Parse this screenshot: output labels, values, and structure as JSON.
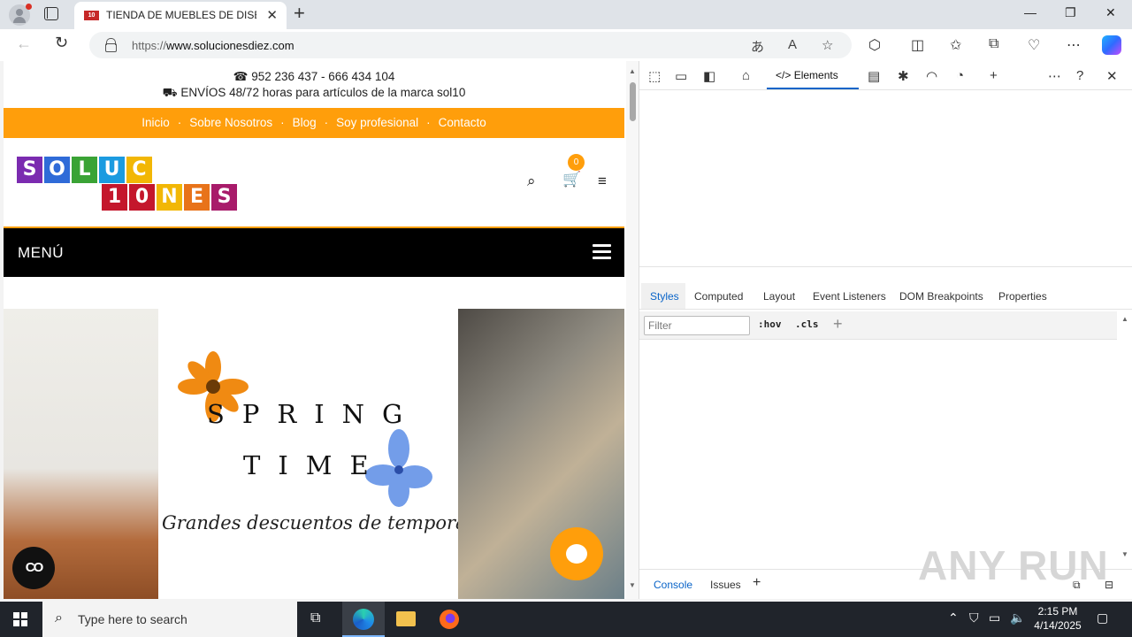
{
  "browser": {
    "tab_title": "TIENDA DE MUEBLES DE DISEÑO",
    "tab_favicon_text": "10",
    "url_prefix": "https://",
    "url_host": "www.solucionesdiez.com"
  },
  "site": {
    "phone": "☎ 952 236 437 - 666 434 104",
    "shipping": "⛟ ENVÍOS 48/72 horas para artículos de la marca sol10",
    "nav": [
      "Inicio",
      "Sobre Nosotros",
      "Blog",
      "Soy profesional",
      "Contacto"
    ],
    "nav_separator": "·",
    "logo_row1": [
      "S",
      "O",
      "L",
      "U",
      "C"
    ],
    "logo_row2": [
      "1",
      "0",
      "N",
      "E",
      "S"
    ],
    "cart_count": "0",
    "menu_label": "MENÚ",
    "banner": {
      "line1": "SPRING",
      "line2": "TIME",
      "tagline": "Grandes descuentos de temporada"
    },
    "cookie_label": "CO",
    "brand_orange": "#ff9e0b"
  },
  "devtools": {
    "main_tab": "Elements",
    "subtabs": [
      "Styles",
      "Computed",
      "Layout",
      "Event Listeners",
      "DOM Breakpoints",
      "Properties"
    ],
    "filter_placeholder": "Filter",
    "hov": ":hov",
    "cls": ".cls",
    "drawer_tabs": [
      "Console",
      "Issues"
    ]
  },
  "watermark": "ANY RUN",
  "taskbar": {
    "search_placeholder": "Type here to search",
    "time": "2:15 PM",
    "date": "4/14/2025"
  }
}
